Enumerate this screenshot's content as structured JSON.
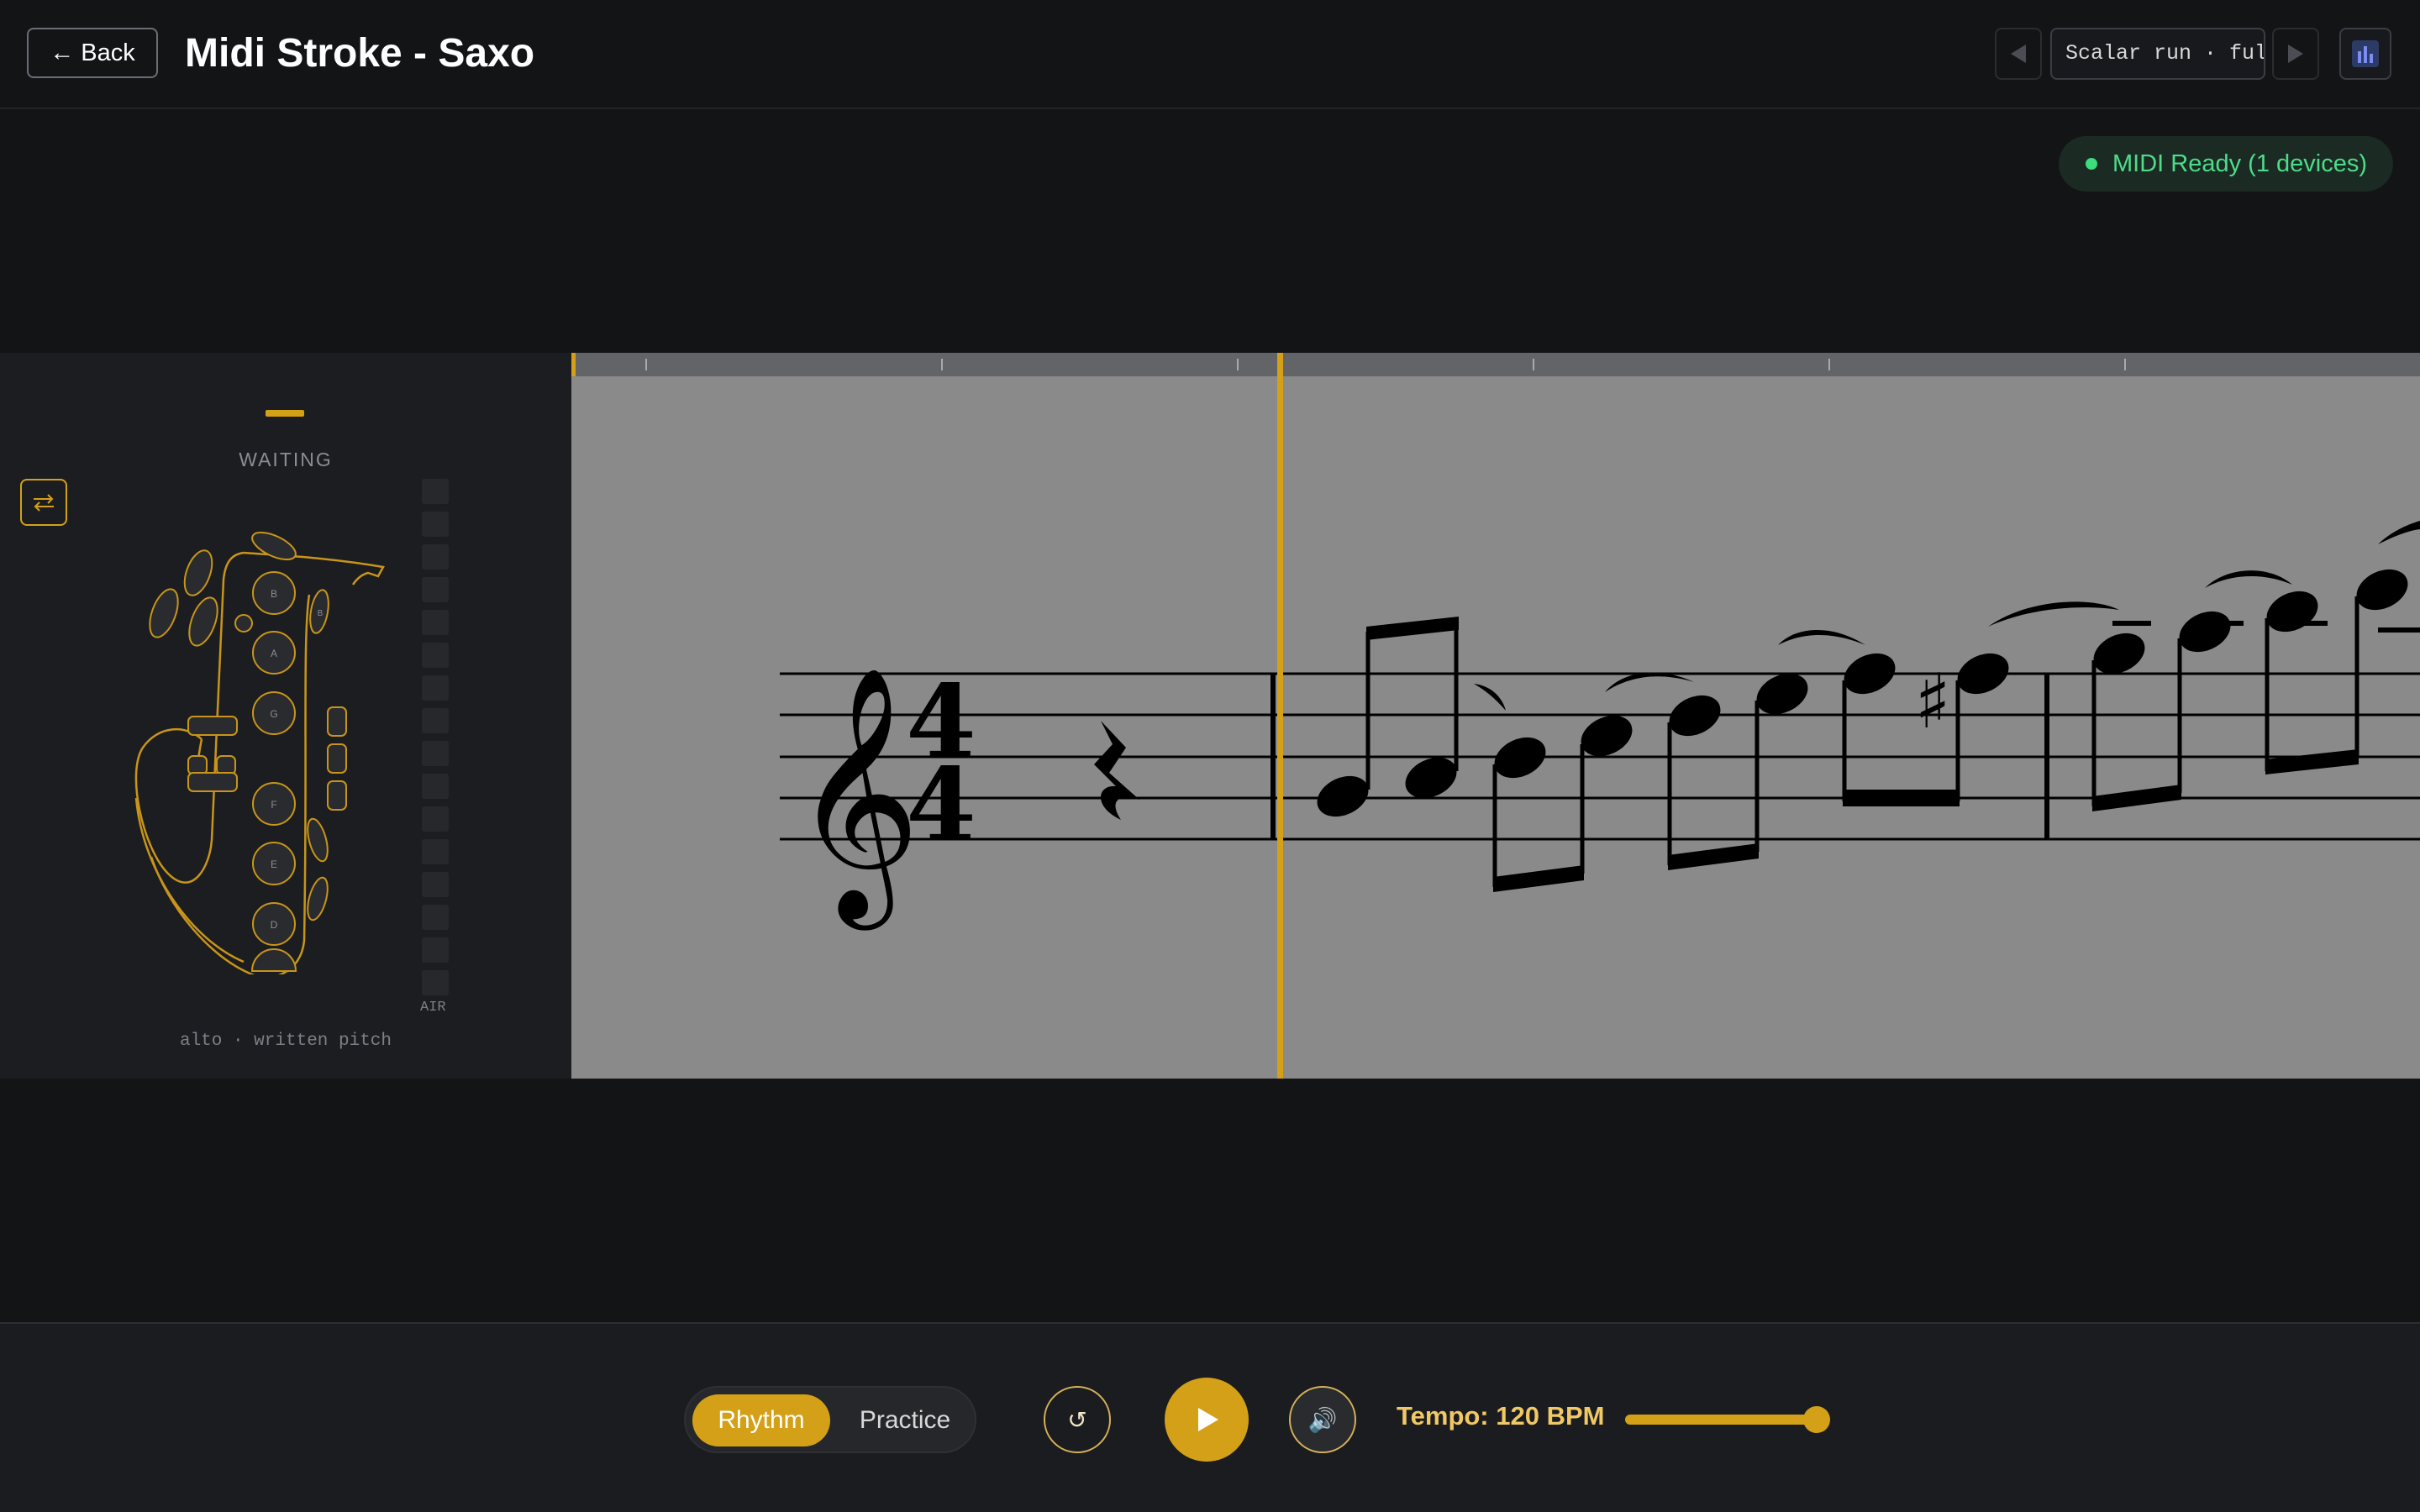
{
  "header": {
    "back_label": "← Back",
    "title": "Midi Stroke - Saxo",
    "exercise_value": "Scalar run · full",
    "prev_icon": "triangle-left-icon",
    "next_icon": "triangle-right-icon",
    "chart_icon": "bar-chart-icon"
  },
  "status": {
    "midi_label": "MIDI Ready (1 devices)",
    "midi_color": "#3ddc7c"
  },
  "sax": {
    "state": "WAITING",
    "caption": "alto · written pitch",
    "air_label": "AIR",
    "air_level": 0,
    "keys": [
      "B",
      "A",
      "G",
      "F",
      "E",
      "D"
    ],
    "side_key_label": "B",
    "swap_icon": "swap-arrows-icon"
  },
  "score": {
    "clef": "treble",
    "time_signature": "4/4",
    "accidental": "♯"
  },
  "controls": {
    "mode_rhythm": "Rhythm",
    "mode_practice": "Practice",
    "active_mode": "Rhythm",
    "reset_icon": "↺",
    "play_icon": "play-icon",
    "metronome_icon": "🔊",
    "tempo_label": "Tempo: 120 BPM",
    "tempo_level": 1.0
  },
  "colors": {
    "accent": "#d4a017",
    "background": "#131416",
    "score_bg": "#8a8a8a"
  }
}
